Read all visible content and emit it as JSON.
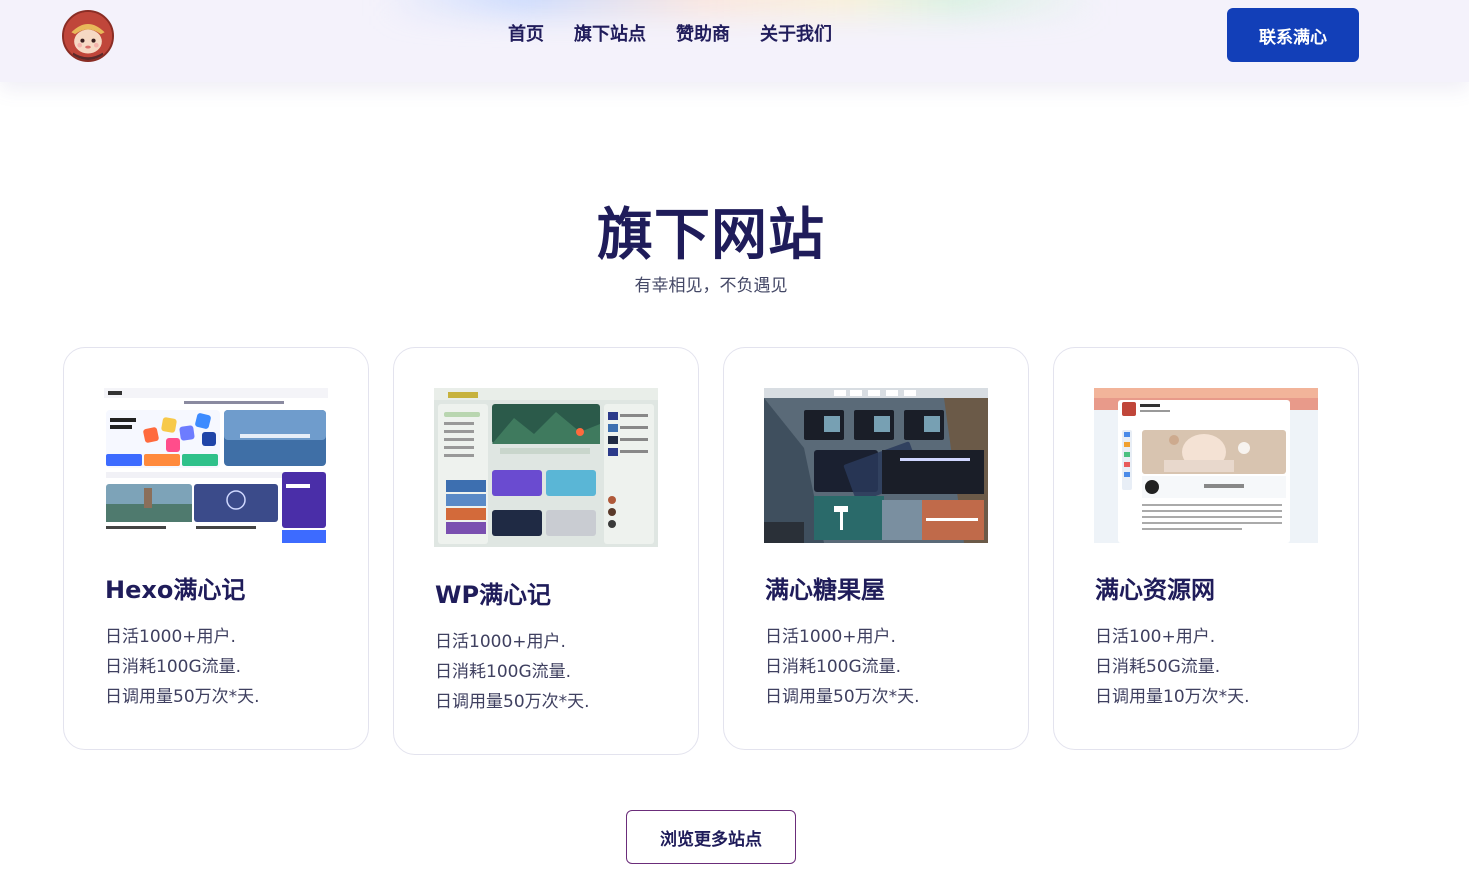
{
  "header": {
    "nav": [
      {
        "label": "首页"
      },
      {
        "label": "旗下站点"
      },
      {
        "label": "赞助商"
      },
      {
        "label": "关于我们"
      }
    ],
    "contact_label": "联系满心"
  },
  "section": {
    "title": "旗下网站",
    "subtitle": "有幸相见，不负遇见"
  },
  "sites": [
    {
      "name": "Hexo满心记",
      "lines": [
        "日活1000+用户.",
        "日消耗100G流量.",
        "日调用量50万次*天."
      ]
    },
    {
      "name": "WP满心记",
      "lines": [
        "日活1000+用户.",
        "日消耗100G流量.",
        "日调用量50万次*天."
      ]
    },
    {
      "name": "满心糖果屋",
      "lines": [
        "日活1000+用户.",
        "日消耗100G流量.",
        "日调用量50万次*天."
      ]
    },
    {
      "name": "满心资源网",
      "lines": [
        "日活100+用户.",
        "日消耗50G流量.",
        "日调用量10万次*天."
      ]
    }
  ],
  "more_label": "浏览更多站点",
  "colors": {
    "primary_button": "#123fb8",
    "title_text": "#1f1c5a",
    "outline_button": "#6b2d7a"
  }
}
